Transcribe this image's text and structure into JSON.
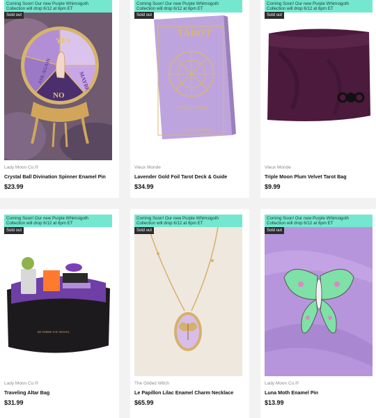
{
  "banner_text": [
    "Coming Soon! Our new Purple Whimsigoth",
    "Collection will drop 6/12 at 6pm ET"
  ],
  "sold_out_label": "Sold out",
  "products": [
    {
      "vendor": "Lady Moon Co.®",
      "title": "Crystal Ball Divination Spinner Enamel Pin",
      "price": "$23.99",
      "image_icon": "crystal-ball-spinner-pin",
      "pin_words": [
        "YES",
        "MAYBE",
        "NO",
        "ASK AGAIN"
      ]
    },
    {
      "vendor": "Vieux Monde",
      "title": "Lavender Gold Foil Tarot Deck & Guide",
      "price": "$34.99",
      "image_icon": "tarot-deck-box",
      "box_words": [
        "TAROT",
        "WHEEL of FORTUNE",
        "Lavender Edition"
      ]
    },
    {
      "vendor": "Vieux Monde",
      "title": "Triple Moon Plum Velvet Tarot Bag",
      "price": "$9.99",
      "image_icon": "velvet-bag"
    },
    {
      "vendor": "Lady Moon Co.®",
      "title": "Traveling Altar Bag",
      "price": "$31.99",
      "image_icon": "altar-bag"
    },
    {
      "vendor": "The Gilded Witch",
      "title": "Le Papillon Lilac Enamel Charm Necklace",
      "price": "$65.99",
      "image_icon": "butterfly-necklace"
    },
    {
      "vendor": "Lady Moon Co.®",
      "title": "Luna Moth Enamel Pin",
      "price": "$13.99",
      "image_icon": "luna-moth-pin"
    }
  ],
  "colors": {
    "banner": "#74e7cf",
    "sold_out": "#2b2b2b",
    "lavender": "#b99fd8",
    "plum": "#4b1a3c"
  }
}
